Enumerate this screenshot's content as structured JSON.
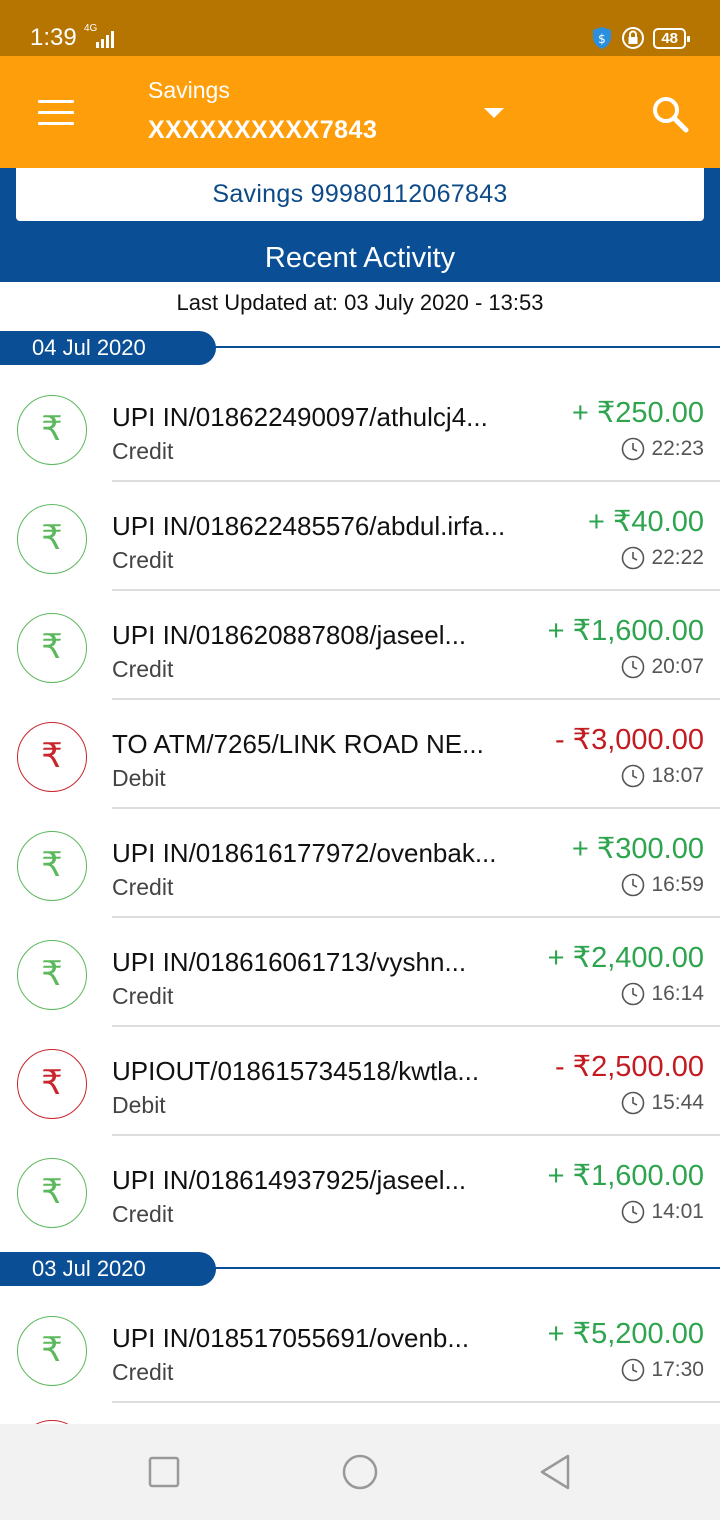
{
  "status_bar": {
    "time": "1:39",
    "network": "4G",
    "battery": "48",
    "icons": [
      "signal-icon",
      "shield-dollar-icon",
      "lock-icon",
      "battery-icon"
    ]
  },
  "header": {
    "account_type": "Savings",
    "account_number_masked": "XXXXXXXXXX7843",
    "icons": [
      "menu-icon",
      "dropdown-caret-icon",
      "search-icon"
    ],
    "background": "#ff9e0b"
  },
  "account_card": {
    "label": "Savings 99980112067843"
  },
  "section": {
    "title": "Recent Activity",
    "last_updated": "Last Updated at: 03 July 2020 - 13:53"
  },
  "groups": [
    {
      "date": "04 Jul 2020",
      "transactions": [
        {
          "description": "UPI IN/018622490097/athulcj4...",
          "type": "Credit",
          "amount": "+ ₹250.00",
          "time": "22:23"
        },
        {
          "description": "UPI IN/018622485576/abdul.irfa...",
          "type": "Credit",
          "amount": "+ ₹40.00",
          "time": "22:22"
        },
        {
          "description": "UPI IN/018620887808/jaseel...",
          "type": "Credit",
          "amount": "+ ₹1,600.00",
          "time": "20:07"
        },
        {
          "description": "TO ATM/7265/LINK ROAD NE...",
          "type": "Debit",
          "amount": "- ₹3,000.00",
          "time": "18:07"
        },
        {
          "description": "UPI IN/018616177972/ovenbak...",
          "type": "Credit",
          "amount": "+ ₹300.00",
          "time": "16:59"
        },
        {
          "description": "UPI IN/018616061713/vyshn...",
          "type": "Credit",
          "amount": "+ ₹2,400.00",
          "time": "16:14"
        },
        {
          "description": "UPIOUT/018615734518/kwtla...",
          "type": "Debit",
          "amount": "- ₹2,500.00",
          "time": "15:44"
        },
        {
          "description": "UPI IN/018614937925/jaseel...",
          "type": "Credit",
          "amount": "+ ₹1,600.00",
          "time": "14:01"
        }
      ]
    },
    {
      "date": "03 Jul 2020",
      "transactions": [
        {
          "description": "UPI IN/018517055691/ovenb...",
          "type": "Credit",
          "amount": "+ ₹5,200.00",
          "time": "17:30"
        }
      ]
    }
  ],
  "rupee_symbol": "₹",
  "colors": {
    "primary_blue": "#0a4f95",
    "credit_green": "#2ea44f",
    "debit_red": "#c41b22",
    "status_bar": "#b57500"
  },
  "nav_bar": {
    "icons": [
      "recents-square-icon",
      "home-circle-icon",
      "back-triangle-icon"
    ]
  }
}
